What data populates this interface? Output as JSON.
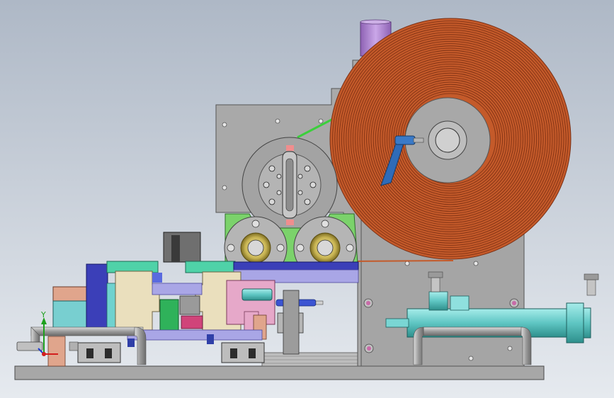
{
  "viewport": {
    "background_top": "#aeb8c6",
    "background_bottom": "#e6eaef"
  },
  "triad": {
    "y_label": "Y",
    "x_color": "#d21e1e",
    "y_color": "#1ea01e",
    "z_color": "#1e3cd2"
  },
  "colors": {
    "coil": "#c45a2a",
    "coil_dark": "#7a2e12",
    "frame": "#a9a9a9",
    "frame_dark": "#6e6e6e",
    "green_plate": "#7bd26b",
    "teal": "#6fd2cf",
    "navy": "#3b3fb8",
    "lavender": "#a9a6e6",
    "beige": "#eadfbd",
    "pink": "#e6a8c9",
    "purple": "#b78fd6",
    "salmon": "#e0a58c",
    "brass": "#c9b553",
    "pipe": "#a4a4a4"
  }
}
